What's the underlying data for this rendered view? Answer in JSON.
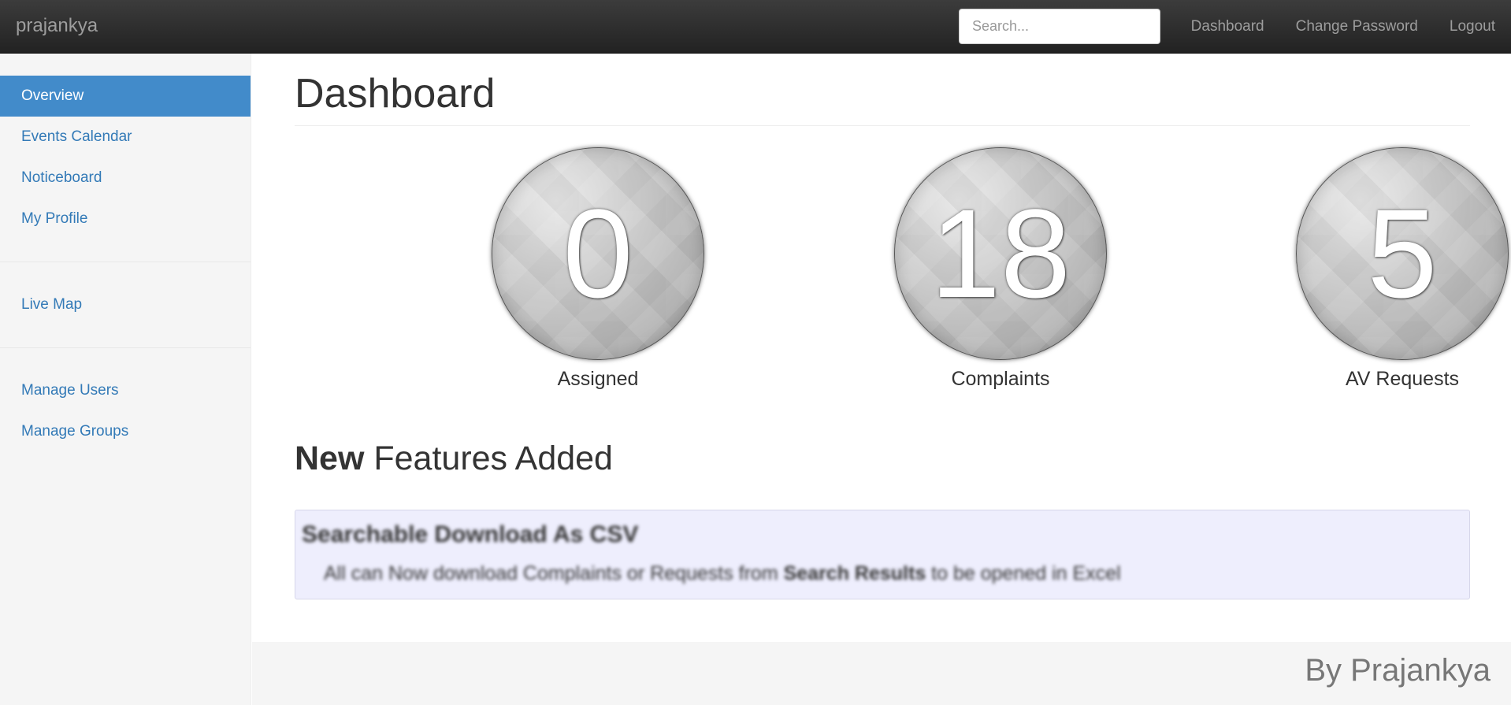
{
  "navbar": {
    "brand": "prajankya",
    "search_placeholder": "Search...",
    "links": [
      "Dashboard",
      "Change Password",
      "Logout"
    ]
  },
  "sidebar": {
    "groups": [
      [
        "Overview",
        "Events Calendar",
        "Noticeboard",
        "My Profile"
      ],
      [
        "Live Map"
      ],
      [
        "Manage Users",
        "Manage Groups"
      ]
    ],
    "active": "Overview"
  },
  "main": {
    "title": "Dashboard",
    "stats": [
      {
        "value": "0",
        "label": "Assigned"
      },
      {
        "value": "18",
        "label": "Complaints"
      },
      {
        "value": "5",
        "label": "AV Requests"
      }
    ],
    "features_heading_bold": "New",
    "features_heading_rest": " Features Added",
    "feature": {
      "title": "Searchable Download As CSV",
      "desc_1": "All can Now download Complaints or Requests from ",
      "desc_bold": "Search Results",
      "desc_2": " to be opened in Excel"
    }
  },
  "footer": {
    "text": "By Prajankya"
  },
  "colors": {
    "navbar": "#222222",
    "link": "#337ab7",
    "active": "#428bca",
    "feature_bg": "#eeeefd"
  }
}
